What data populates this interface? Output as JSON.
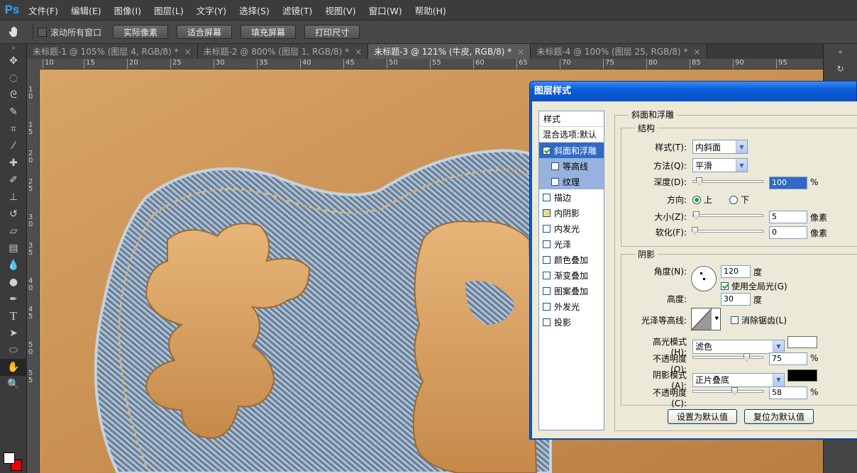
{
  "app": {
    "logo": "Ps"
  },
  "menu": [
    "文件(F)",
    "编辑(E)",
    "图像(I)",
    "图层(L)",
    "文字(Y)",
    "选择(S)",
    "滤镜(T)",
    "视图(V)",
    "窗口(W)",
    "帮助(H)"
  ],
  "options": {
    "scroll_all_label": "滚动所有窗口",
    "buttons": [
      "实际像素",
      "适合屏幕",
      "填充屏幕",
      "打印尺寸"
    ]
  },
  "tabs": [
    {
      "label": "未标题-1 @ 105% (图层 4, RGB/8) *",
      "close": "×"
    },
    {
      "label": "未标题-2 @ 800% (图层 1, RGB/8) *",
      "close": "×"
    },
    {
      "label": "未标题-3 @ 121% (牛皮, RGB/8) *",
      "close": "×"
    },
    {
      "label": "未标题-4 @ 100% (图层 25, RGB/8) *",
      "close": "×"
    }
  ],
  "ruler_h": [
    "10",
    "15",
    "20",
    "25",
    "30",
    "35",
    "40",
    "45",
    "50",
    "55",
    "60",
    "65",
    "70",
    "75",
    "80",
    "85",
    "90",
    "95"
  ],
  "ruler_v": [
    "10",
    "15",
    "20",
    "25",
    "30",
    "35",
    "40",
    "45",
    "50",
    "55"
  ],
  "dialog": {
    "title": "图层样式",
    "styles_header": "样式",
    "blend_options": "混合选项:默认",
    "style_items": [
      {
        "label": "斜面和浮雕",
        "checked": true
      },
      {
        "label": "等高线",
        "checked": false
      },
      {
        "label": "纹理",
        "checked": false
      },
      {
        "label": "描边",
        "checked": false
      },
      {
        "label": "内阴影",
        "checked": true
      },
      {
        "label": "内发光",
        "checked": false
      },
      {
        "label": "光泽",
        "checked": false
      },
      {
        "label": "颜色叠加",
        "checked": false
      },
      {
        "label": "渐变叠加",
        "checked": false
      },
      {
        "label": "图案叠加",
        "checked": false
      },
      {
        "label": "外发光",
        "checked": false
      },
      {
        "label": "投影",
        "checked": false
      }
    ],
    "bevel_group": "斜面和浮雕",
    "structure_group": "结构",
    "style_label": "样式(T):",
    "style_value": "内斜面",
    "technique_label": "方法(Q):",
    "technique_value": "平滑",
    "depth_label": "深度(D):",
    "depth_value": "100",
    "depth_percent": 1.0,
    "percent": "%",
    "direction_label": "方向:",
    "dir_up": "上",
    "dir_down": "下",
    "size_label": "大小(Z):",
    "size_value": "5",
    "soften_label": "软化(F):",
    "soften_value": "0",
    "pixels": "像素",
    "shading_group": "阴影",
    "angle_label": "角度(N):",
    "angle_value": "120",
    "degree": "度",
    "global_light": "使用全局光(G)",
    "altitude_label": "高度:",
    "altitude_value": "30",
    "gloss_label": "光泽等高线:",
    "anti_alias": "消除锯齿(L)",
    "highlight_mode_label": "高光模式(H):",
    "highlight_mode_value": "滤色",
    "highlight_opacity_label": "不透明度(O):",
    "highlight_opacity_value": "75",
    "shadow_mode_label": "阴影模式(A):",
    "shadow_mode_value": "正片叠底",
    "shadow_opacity_label": "不透明度(C):",
    "shadow_opacity_value": "58",
    "highlight_color": "#ffffff",
    "shadow_color": "#000000",
    "make_default": "设置为默认值",
    "reset_default": "复位为默认值"
  }
}
